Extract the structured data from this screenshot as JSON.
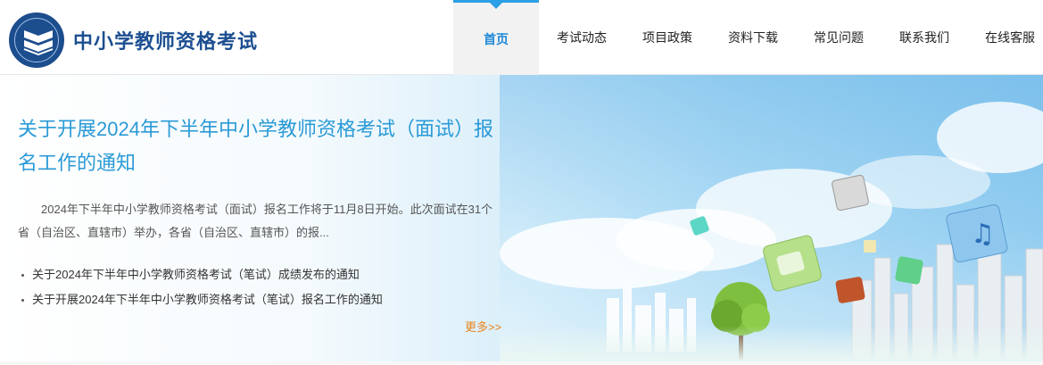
{
  "header": {
    "site_title": "中小学教师资格考试",
    "logo_icon": "book-shield-icon"
  },
  "nav": {
    "items": [
      {
        "label": "首页",
        "active": true
      },
      {
        "label": "考试动态",
        "active": false
      },
      {
        "label": "项目政策",
        "active": false
      },
      {
        "label": "资料下载",
        "active": false
      },
      {
        "label": "常见问题",
        "active": false
      },
      {
        "label": "联系我们",
        "active": false
      },
      {
        "label": "在线客服",
        "active": false
      }
    ]
  },
  "banner": {
    "headline": "关于开展2024年下半年中小学教师资格考试（面试）报名工作的通知",
    "summary": "2024年下半年中小学教师资格考试（面试）报名工作将于11月8日开始。此次面试在31个省（自治区、直辖市）举办，各省（自治区、直辖市）的报...",
    "links": [
      "关于2024年下半年中小学教师资格考试（笔试）成绩发布的通知",
      "关于开展2024年下半年中小学教师资格考试（笔试）报名工作的通知"
    ],
    "more": "更多>>"
  },
  "colors": {
    "brand": "#1d4f91",
    "accent": "#2ba0e6",
    "headline": "#2a9ad6",
    "more": "#e8841a"
  }
}
